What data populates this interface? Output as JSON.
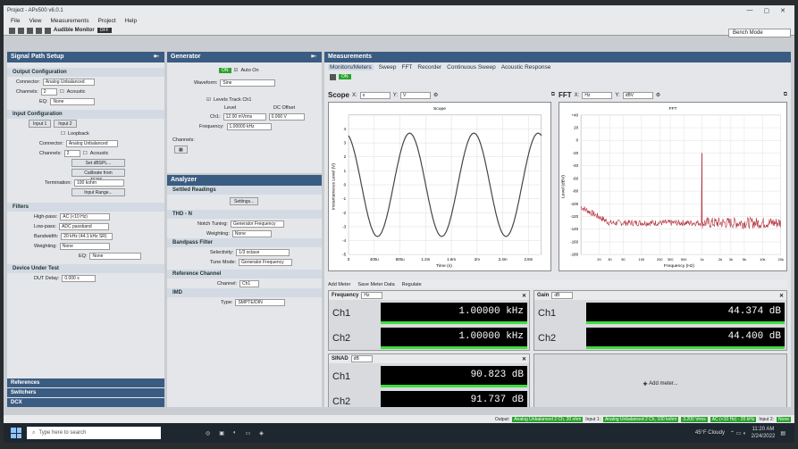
{
  "window": {
    "title": "Project - APx500 v6.0.1"
  },
  "menu": [
    "File",
    "View",
    "Measurements",
    "Project",
    "Help"
  ],
  "toolbar": {
    "audible_monitor": "Audible Monitor",
    "off": "OFF"
  },
  "bench_mode": "Bench Mode",
  "signal_path": {
    "title": "Signal Path Setup",
    "output": {
      "title": "Output Configuration",
      "connector_label": "Connector:",
      "connector": "Analog Unbalanced",
      "channels_label": "Channels:",
      "channels": "2",
      "acoustic": "Acoustic",
      "eq_label": "EQ:",
      "eq": "None"
    },
    "input": {
      "title": "Input Configuration",
      "tabs": [
        "Input 1",
        "Input 2"
      ],
      "loopback": "Loopback",
      "connector_label": "Connector:",
      "connector": "Analog Unbalanced",
      "channels_label": "Channels:",
      "channels": "2",
      "acoustic": "Acoustic",
      "set_dbspl": "Set dBSPL...",
      "calibrate": "Calibrate from TEDS...",
      "termination_label": "Termination:",
      "termination": "100 kohm",
      "input_range": "Input Range..."
    },
    "filters": {
      "title": "Filters",
      "highpass_label": "High-pass:",
      "highpass": "AC (<10 Hz)",
      "lowpass_label": "Low-pass:",
      "lowpass": "ADC passband",
      "bandwidth_label": "Bandwidth:",
      "bandwidth": "20 kHz (44.1 kHz SR)",
      "weighting_label": "Weighting:",
      "weighting": "None",
      "eq_label": "EQ:",
      "eq": "None"
    },
    "dut": {
      "title": "Device Under Test",
      "delay_label": "DUT Delay:",
      "delay": "0.000 s"
    },
    "links": [
      "References",
      "Switchers",
      "DCX"
    ]
  },
  "generator": {
    "title": "Generator",
    "on": "ON",
    "auto_on": "Auto On",
    "waveform_label": "Waveform:",
    "waveform": "Sine",
    "levels_track": "Levels Track Ch1",
    "level_hdr": "Level",
    "dc_hdr": "DC Offset",
    "ch1": "Ch1:",
    "level": "12.00 mVrms",
    "dc": "0.000 V",
    "frequency_label": "Frequency:",
    "frequency": "1.00000 kHz",
    "channels_label": "Channels:"
  },
  "analyzer": {
    "title": "Analyzer",
    "settled": "Settled Readings",
    "settings": "Settings...",
    "thdn": "THD - N",
    "notch_label": "Notch Tuning:",
    "notch": "Generator Frequency",
    "weighting_label": "Weighting:",
    "weighting": "None",
    "bandpass": "Bandpass Filter",
    "selectivity_label": "Selectivity:",
    "selectivity": "1/3 octave",
    "tune_label": "Tune Mode:",
    "tune": "Generator Frequency",
    "ref_channel": "Reference Channel",
    "channel_label": "Channel:",
    "channel": "Ch1",
    "imd": "IMD",
    "type_label": "Type:",
    "type": "SMPTE/DIN"
  },
  "measurements": {
    "title": "Measurements",
    "tabs": [
      "Monitors/Meters",
      "Sweep",
      "FFT",
      "Recorder",
      "Continuous Sweep",
      "Acoustic Response"
    ],
    "on": "ON"
  },
  "scope": {
    "label": "Scope",
    "x": "X:",
    "xunit": "s",
    "y": "Y:",
    "yunit": "V",
    "plot_title": "Scope",
    "ylabel": "Instantaneous Level (V)",
    "xlabel": "Time (s)"
  },
  "fft": {
    "label": "FFT",
    "x": "X:",
    "xunit": "Hz",
    "y": "Y:",
    "yunit": "dBV",
    "plot_title": "FFT",
    "ylabel": "Level (dBV)",
    "xlabel": "Frequency (Hz)"
  },
  "chart_data": [
    {
      "type": "line",
      "title": "Scope",
      "xlabel": "Time (s)",
      "ylabel": "Instantaneous Level (V)",
      "xlim": [
        0,
        0.003
      ],
      "ylim": [
        -5,
        5
      ],
      "x_ticks": [
        "0",
        "400u",
        "800u",
        "1.2m",
        "1.6m",
        "2m",
        "2.4m",
        "2.8m"
      ],
      "y_ticks": [
        "4",
        "3",
        "2",
        "1",
        "0",
        "-1",
        "-2",
        "-3",
        "-4",
        "-5"
      ],
      "series": [
        {
          "waveform": "sine",
          "frequency_hz": 1000,
          "amplitude_v": 3.7
        }
      ]
    },
    {
      "type": "line",
      "title": "FFT",
      "xlabel": "Frequency (Hz)",
      "ylabel": "Level (dBV)",
      "xscale": "log",
      "xlim": [
        10,
        20000
      ],
      "ylim": [
        -180,
        40
      ],
      "x_ticks": [
        "20",
        "30",
        "50",
        "100",
        "200",
        "300",
        "500",
        "1k",
        "2k",
        "3k",
        "5k",
        "10k",
        "20k"
      ],
      "y_ticks": [
        "+40",
        "20",
        "0",
        "-20",
        "-40",
        "-60",
        "-80",
        "-100",
        "-120",
        "-140",
        "-160",
        "-180"
      ],
      "peak": {
        "x": 1000,
        "y": -20
      },
      "noise_floor_db": -130
    }
  ],
  "meter_toolbar": {
    "add": "Add Meter",
    "save": "Save Meter Data",
    "regulate": "Regulate"
  },
  "meters": {
    "frequency": {
      "title": "Frequency",
      "unit": "Hz",
      "ch1": "Ch1",
      "ch2": "Ch2",
      "v1": "1.00000",
      "v2": "1.00000",
      "u": "kHz"
    },
    "gain": {
      "title": "Gain",
      "unit": "dB",
      "ch1": "Ch1",
      "ch2": "Ch2",
      "v1": "44.374",
      "v2": "44.400",
      "u": "dB"
    },
    "sinad": {
      "title": "SINAD",
      "unit": "dB",
      "ch1": "Ch1",
      "ch2": "Ch2",
      "v1": "90.823",
      "v2": "91.737",
      "u": "dB"
    },
    "add_meter": "Add meter..."
  },
  "status": {
    "output": "Output:",
    "out_val": "Analog Unbalanced 2 Ch, 20 ohm",
    "input1": "Input 1:",
    "in_val": "Analog Unbalanced 2 Ch, 100 kohm",
    "rms": "3.200 Vrms",
    "ac": "AC (<10 Hz) - 20 kHz",
    "input2": "Input 2:",
    "none": "None"
  },
  "taskbar": {
    "search": "Type here to search",
    "weather": "45°F Cloudy",
    "time": "11:20 AM",
    "date": "2/24/2022"
  }
}
